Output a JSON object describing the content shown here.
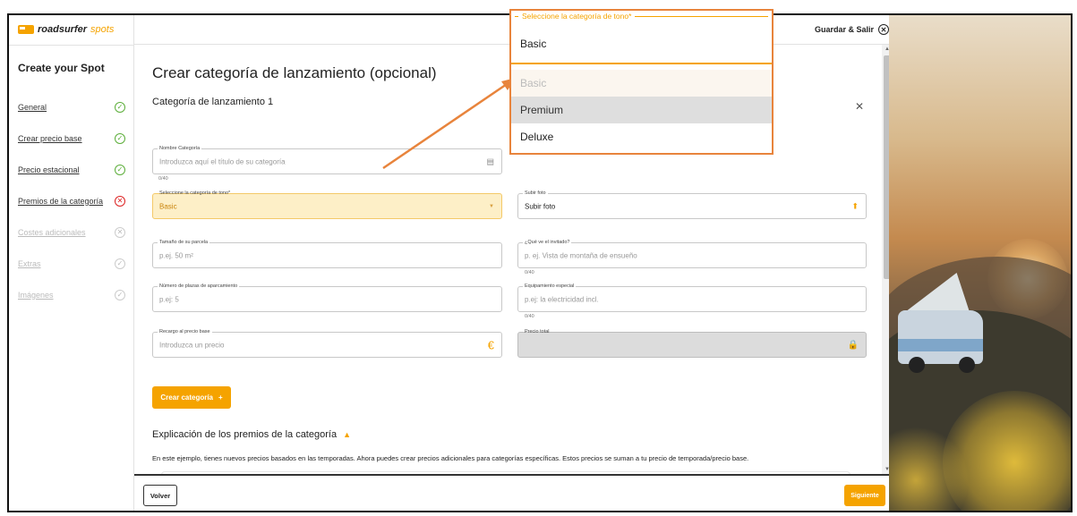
{
  "brand": {
    "name": "roadsurfer",
    "suffix": "spots"
  },
  "sidebar": {
    "title": "Create your Spot",
    "steps": [
      {
        "label": "General",
        "status": "done"
      },
      {
        "label": "Crear precio base",
        "status": "done"
      },
      {
        "label": "Precio estacional",
        "status": "done"
      },
      {
        "label": "Premios de la categoría",
        "status": "error"
      },
      {
        "label": "Costes adicionales",
        "status": "error-dim"
      },
      {
        "label": "Extras",
        "status": "done-dim"
      },
      {
        "label": "Imágenes",
        "status": "done-dim"
      }
    ]
  },
  "topbar": {
    "save_exit": "Guardar & Salir"
  },
  "main": {
    "title": "Crear categoría de lanzamiento (opcional)",
    "subtitle": "Categoría de lanzamiento 1",
    "fields": {
      "nombre": {
        "label": "Nombre Categoría",
        "placeholder": "Introduzca aquí el título de su categoría",
        "counter": "0/40"
      },
      "tono": {
        "label": "Seleccione la categoría de tono*",
        "value": "Basic"
      },
      "foto": {
        "label": "Subir foto",
        "value": "Subir foto"
      },
      "parcela": {
        "label": "Tamaño de su parcela",
        "placeholder": "p.ej. 50 m²"
      },
      "invitado": {
        "label": "¿Qué ve el invitado?",
        "placeholder": "p. ej. Vista de montaña de ensueño",
        "counter": "0/40"
      },
      "aparcamiento": {
        "label": "Número de plazas de aparcamiento",
        "placeholder": "p.ej: 5"
      },
      "equipamiento": {
        "label": "Equipamiento especial",
        "placeholder": "p.ej: la electricidad incl.",
        "counter": "0/40"
      },
      "recargo": {
        "label": "Recargo al precio base",
        "placeholder": "Introduzca un precio",
        "currency": "€"
      },
      "total": {
        "label": "Precio total"
      }
    },
    "create_button": "Crear categoría",
    "create_plus": "+",
    "explanation_title": "Explicación de los premios de la categoría",
    "explanation_text": "En este ejemplo, tienes nuevos precios basados en las temporadas. Ahora puedes crear precios adicionales para categorías específicas. Estos precios se suman a tu precio de temporada/precio base."
  },
  "bottombar": {
    "back": "Volver",
    "next": "Siguiente"
  },
  "dropdown_zoom": {
    "label": "Seleccione la categoría de tono*",
    "selected": "Basic",
    "options": [
      {
        "label": "Basic",
        "state": "disabled"
      },
      {
        "label": "Premium",
        "state": "hover"
      },
      {
        "label": "Deluxe",
        "state": "normal"
      }
    ]
  },
  "colors": {
    "accent": "#f5a300",
    "annotation": "#e8843c",
    "success": "#5cae3a",
    "error": "#d22222"
  }
}
